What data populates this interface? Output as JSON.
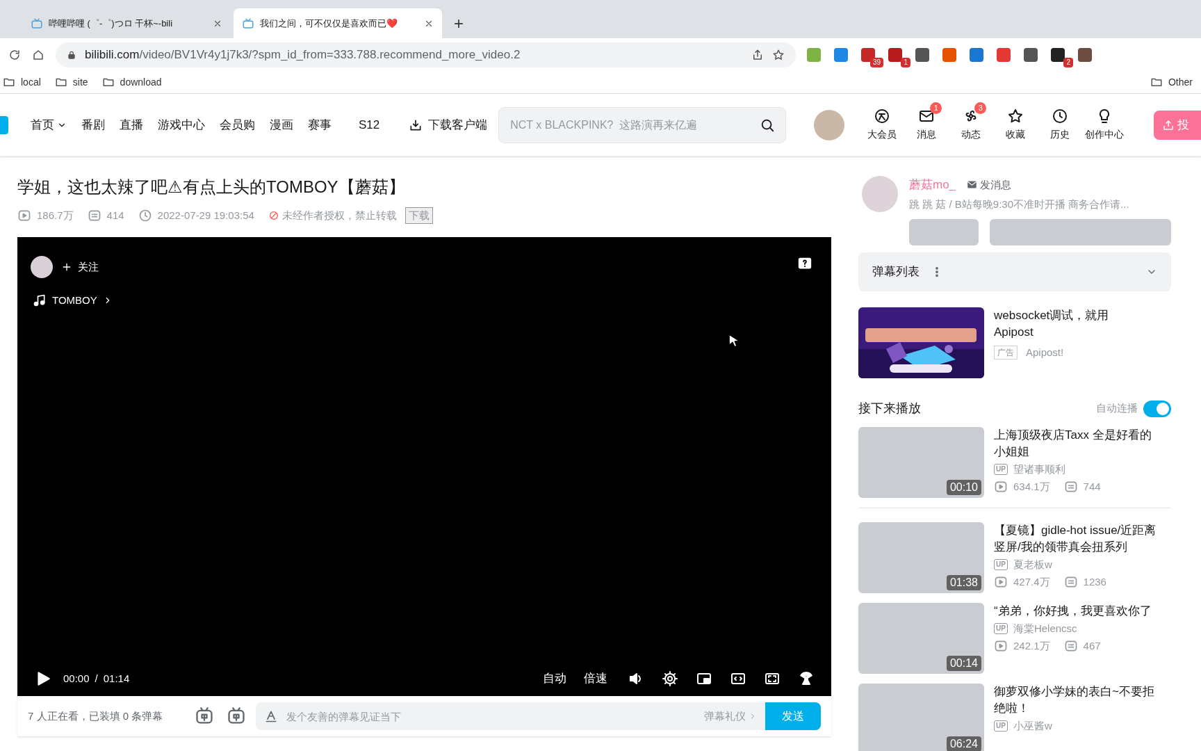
{
  "browser": {
    "tabs": [
      {
        "title": "哔哩哔哩 (゜-゜)つロ 干杯~-bili",
        "selected": false
      },
      {
        "title": "我们之间，可不仅仅是喜欢而已❤️",
        "selected": true
      }
    ],
    "new_tab": "+",
    "url_host": "bilibili.com",
    "url_path": "/video/BV1Vr4y1j7k3/?spm_id_from=333.788.recommend_more_video.2",
    "extensions": [
      {
        "kind": "icon"
      },
      {
        "kind": "icon"
      },
      {
        "kind": "icon",
        "badge": "39"
      },
      {
        "kind": "icon",
        "badge": "1"
      },
      {
        "kind": "icon"
      },
      {
        "kind": "icon"
      },
      {
        "kind": "icon"
      },
      {
        "kind": "icon"
      },
      {
        "kind": "icon"
      },
      {
        "kind": "icon",
        "badge": "2"
      },
      {
        "kind": "icon"
      }
    ],
    "bookmarks": [
      "local",
      "site",
      "download"
    ],
    "other_bookmarks": "Other"
  },
  "nav": {
    "items": [
      {
        "label": "首页",
        "dropdown": true
      },
      {
        "label": "番剧",
        "dropdown": false
      },
      {
        "label": "直播",
        "dropdown": false
      },
      {
        "label": "游戏中心",
        "dropdown": false
      },
      {
        "label": "会员购",
        "dropdown": false
      },
      {
        "label": "漫画",
        "dropdown": false
      },
      {
        "label": "赛事",
        "dropdown": false
      },
      {
        "label": "S12",
        "dropdown": false
      }
    ],
    "download": "下载客户端",
    "search": {
      "placeholder": "NCT x BLACKPINK?  这路演再来亿遍"
    },
    "actions": [
      {
        "kind": "vip",
        "label": "大会员"
      },
      {
        "kind": "message",
        "label": "消息",
        "badge": "1"
      },
      {
        "kind": "dynamic",
        "label": "动态",
        "badge": "3"
      },
      {
        "kind": "favorite",
        "label": "收藏"
      },
      {
        "kind": "history",
        "label": "历史"
      },
      {
        "kind": "create",
        "label": "创作中心"
      }
    ],
    "upload": "投"
  },
  "video": {
    "title": "学姐，这也太辣了吧⚠有点上头的TOMBOY【蘑菇】",
    "views": "186.7万",
    "danmaku": "414",
    "date": "2022-07-29 19:03:54",
    "notice": "未经作者授权，禁止转载",
    "download": "下载"
  },
  "player": {
    "follow": "关注",
    "song": "TOMBOY",
    "current": "00:00",
    "separator": "/",
    "duration": "01:14",
    "quality": "自动",
    "speed": "倍速"
  },
  "danmaku_bar": {
    "status": "7 人正在看，已装填 0 条弹幕",
    "placeholder": "发个友善的弹幕见证当下",
    "etiquette": "弹幕礼仪",
    "send": "发送"
  },
  "uploader": {
    "name": "蘑菇mo_",
    "message": "发消息",
    "bio": "跳 跳 菇 / B站每晚9:30不准时开播 商务合作请..."
  },
  "danmaku_list": {
    "title": "弹幕列表",
    "expanded": false
  },
  "ad": {
    "title": "websocket调试，就用Apipost",
    "tag": "广告",
    "source": "Apipost!"
  },
  "up_next": {
    "title": "接下来播放",
    "autoplay_label": "自动连播",
    "autoplay": true
  },
  "videos": [
    {
      "title": "上海顶级夜店Taxx 全是好看的小姐姐",
      "up_tag": "UP",
      "up": "望诸事顺利",
      "views": "634.1万",
      "danmaku": "744",
      "duration": "00:10"
    },
    {
      "title": "【夏镜】gidle-hot issue/近距离竖屏/我的领带真会扭系列",
      "up_tag": "UP",
      "up": "夏老板w",
      "views": "427.4万",
      "danmaku": "1236",
      "duration": "01:38"
    },
    {
      "title": "“弟弟，你好拽，我更喜欢你了",
      "up_tag": "UP",
      "up": "海棠Helencsc",
      "views": "242.1万",
      "danmaku": "467",
      "duration": "00:14"
    },
    {
      "title": "御萝双修小学妹的表白~不要拒绝啦！",
      "up_tag": "UP",
      "up": "小巫酱w",
      "duration": "06:24"
    }
  ]
}
